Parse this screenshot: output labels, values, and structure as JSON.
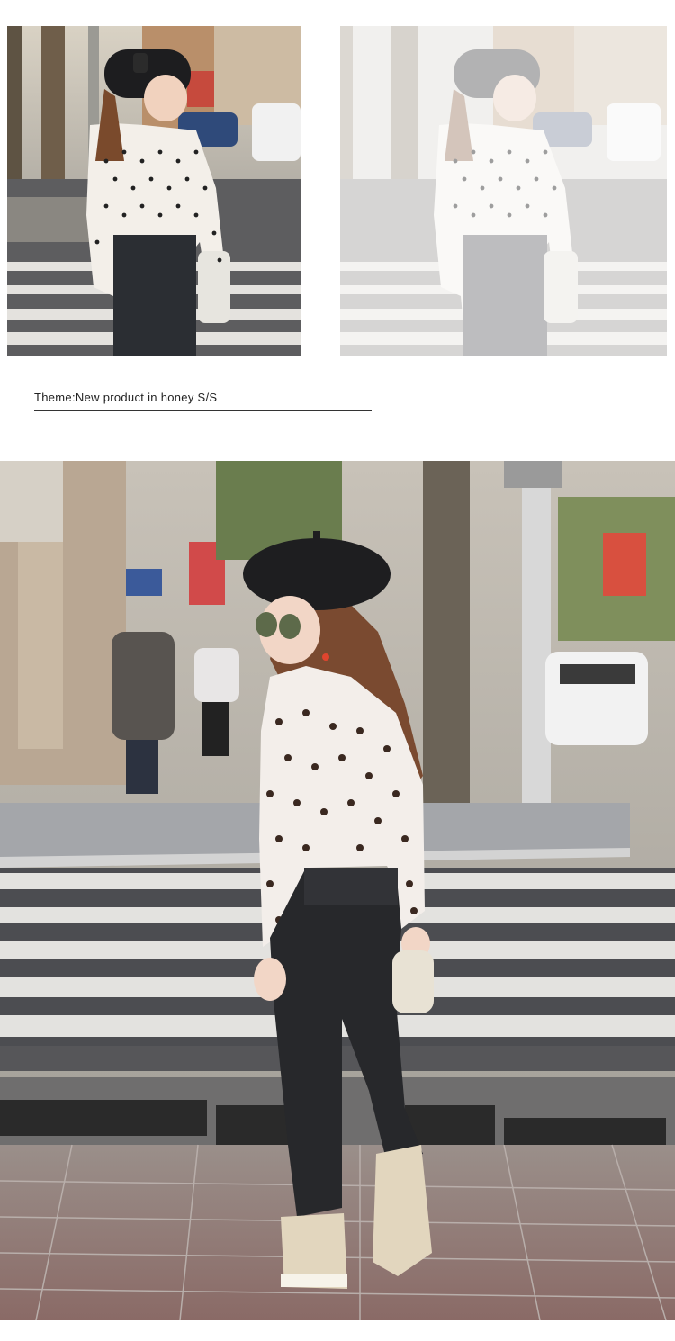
{
  "theme": {
    "prefix": "Theme:",
    "text": "New product in  honey  S/S"
  },
  "photos": {
    "top_left": "street-photo",
    "top_right": "street-photo-faded",
    "main": "street-photo-crosswalk"
  },
  "colors": {
    "background": "#ffffff",
    "divider": "#333333",
    "text": "#222222"
  }
}
